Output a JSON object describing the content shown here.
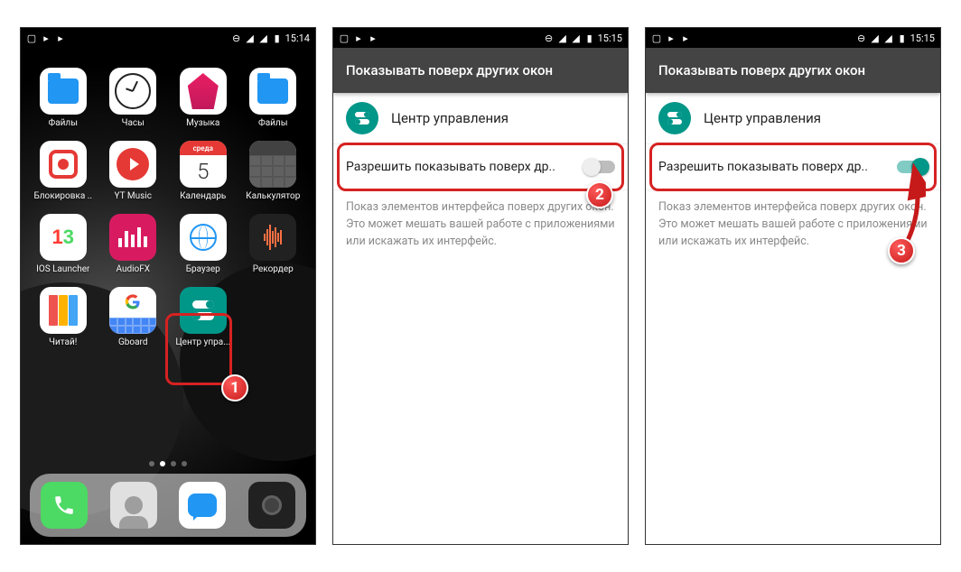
{
  "statusbar": {
    "time_home": "15:14",
    "time_settings": "15:15"
  },
  "home": {
    "apps": [
      {
        "label": "Файлы",
        "icon": "folder"
      },
      {
        "label": "Часы",
        "icon": "clock"
      },
      {
        "label": "Музыка",
        "icon": "music"
      },
      {
        "label": "Файлы",
        "icon": "folder"
      },
      {
        "label": "Блокировка ..",
        "icon": "rec"
      },
      {
        "label": "YT Music",
        "icon": "yt"
      },
      {
        "label": "Календарь",
        "icon": "cal",
        "cal_day_name": "среда",
        "cal_day_num": "5"
      },
      {
        "label": "Калькулятор",
        "icon": "calc"
      },
      {
        "label": "IOS Launcher",
        "icon": "ios"
      },
      {
        "label": "AudioFX",
        "icon": "afx"
      },
      {
        "label": "Браузер",
        "icon": "browser"
      },
      {
        "label": "Рекордер",
        "icon": "wave"
      },
      {
        "label": "Читай!",
        "icon": "read"
      },
      {
        "label": "Gboard",
        "icon": "gboard"
      },
      {
        "label": "Центр упра...",
        "icon": "cc"
      }
    ],
    "dock": [
      {
        "icon": "phone"
      },
      {
        "icon": "contacts"
      },
      {
        "icon": "messages"
      },
      {
        "icon": "camera"
      }
    ]
  },
  "settings": {
    "header": "Показывать поверх других окон",
    "app_name": "Центр управления",
    "toggle_label": "Разрешить показывать поверх др..",
    "description": "Показ элементов интерфейса поверх других окон. Это может мешать вашей работе с приложениями или искажать их интерфейс."
  },
  "badges": {
    "b1": "1",
    "b2": "2",
    "b3": "3"
  },
  "colors": {
    "accent": "#009688",
    "highlight": "#d62222"
  }
}
